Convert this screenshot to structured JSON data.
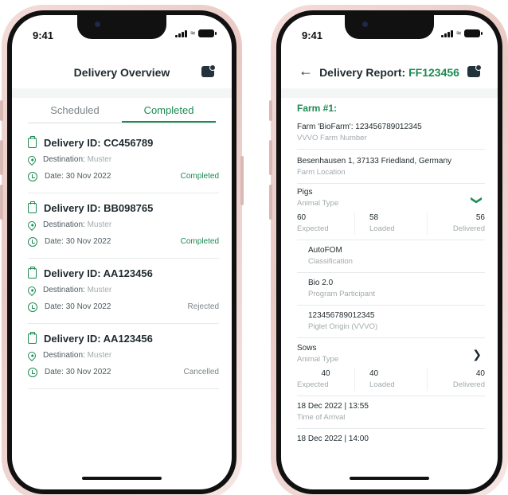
{
  "status_bar": {
    "time": "9:41"
  },
  "overview": {
    "title": "Delivery Overview",
    "tabs": [
      {
        "label": "Scheduled"
      },
      {
        "label": "Completed"
      }
    ],
    "destination_label": "Destination:",
    "date_label": "Date:",
    "deliveries": [
      {
        "id": "Delivery ID: CC456789",
        "destination": "Muster",
        "date": "30 Nov 2022",
        "status": "Completed"
      },
      {
        "id": "Delivery ID: BB098765",
        "destination": "Muster",
        "date": "30 Nov 2022",
        "status": "Completed"
      },
      {
        "id": "Delivery ID: AA123456",
        "destination": "Muster",
        "date": "30 Nov 2022",
        "status": "Rejected"
      },
      {
        "id": "Delivery ID: AA123456",
        "destination": "Muster",
        "date": "30 Nov 2022",
        "status": "Cancelled"
      }
    ]
  },
  "report": {
    "title_prefix": "Delivery Report: ",
    "title_id": "FF123456",
    "farm_heading": "Farm #1:",
    "vvvo_value": "Farm 'BioFarm': 123456789012345",
    "vvvo_label": "VVVO Farm Number",
    "location_value": "Besenhausen 1, 37133 Friedland, Germany",
    "location_label": "Farm Location",
    "pigs": {
      "value": "Pigs",
      "label": "Animal Type",
      "expected": "60",
      "loaded": "58",
      "delivered": "56",
      "expected_label": "Expected",
      "loaded_label": "Loaded",
      "delivered_label": "Delivered",
      "classification_value": "AutoFOM",
      "classification_label": "Classification",
      "program_value": "Bio 2.0",
      "program_label": "Program Participant",
      "origin_value": "123456789012345",
      "origin_label": "Piglet Origin (VVVO)"
    },
    "sows": {
      "value": "Sows",
      "label": "Animal Type",
      "expected": "40",
      "loaded": "40",
      "delivered": "40",
      "expected_label": "Expected",
      "loaded_label": "Loaded",
      "delivered_label": "Delivered"
    },
    "arrival_value": "18 Dec 2022 | 13:55",
    "arrival_label": "Time of Arrival",
    "next_value": "18 Dec 2022 | 14:00"
  },
  "colors": {
    "accent": "#1c8a52",
    "text": "#1f2a2e",
    "muted": "#a2aaad"
  }
}
